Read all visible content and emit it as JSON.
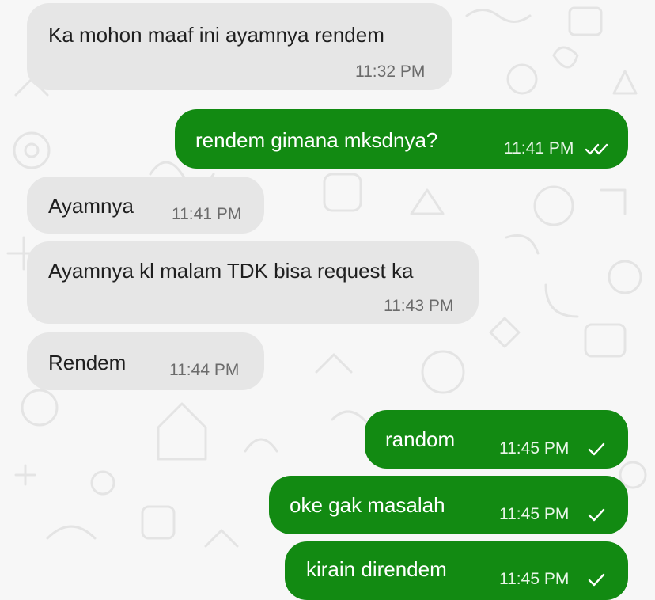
{
  "colors": {
    "incoming_bubble": "#e6e6e6",
    "outgoing_bubble": "#128a12",
    "background": "#f7f7f7"
  },
  "messages": [
    {
      "direction": "incoming",
      "text": "Ka mohon maaf ini ayamnya rendem",
      "time": "11:32 PM"
    },
    {
      "direction": "outgoing",
      "text": "rendem gimana mksdnya?",
      "time": "11:41 PM",
      "status_icon": "double-check-icon"
    },
    {
      "direction": "incoming",
      "text": "Ayamnya",
      "time": "11:41 PM"
    },
    {
      "direction": "incoming",
      "text": "Ayamnya kl malam TDK bisa request ka",
      "time": "11:43 PM"
    },
    {
      "direction": "incoming",
      "text": "Rendem",
      "time": "11:44 PM"
    },
    {
      "direction": "outgoing",
      "text": "random",
      "time": "11:45 PM",
      "status_icon": "check-icon"
    },
    {
      "direction": "outgoing",
      "text": "oke gak masalah",
      "time": "11:45 PM",
      "status_icon": "check-icon"
    },
    {
      "direction": "outgoing",
      "text": "kirain direndem",
      "time": "11:45 PM",
      "status_icon": "check-icon"
    }
  ]
}
